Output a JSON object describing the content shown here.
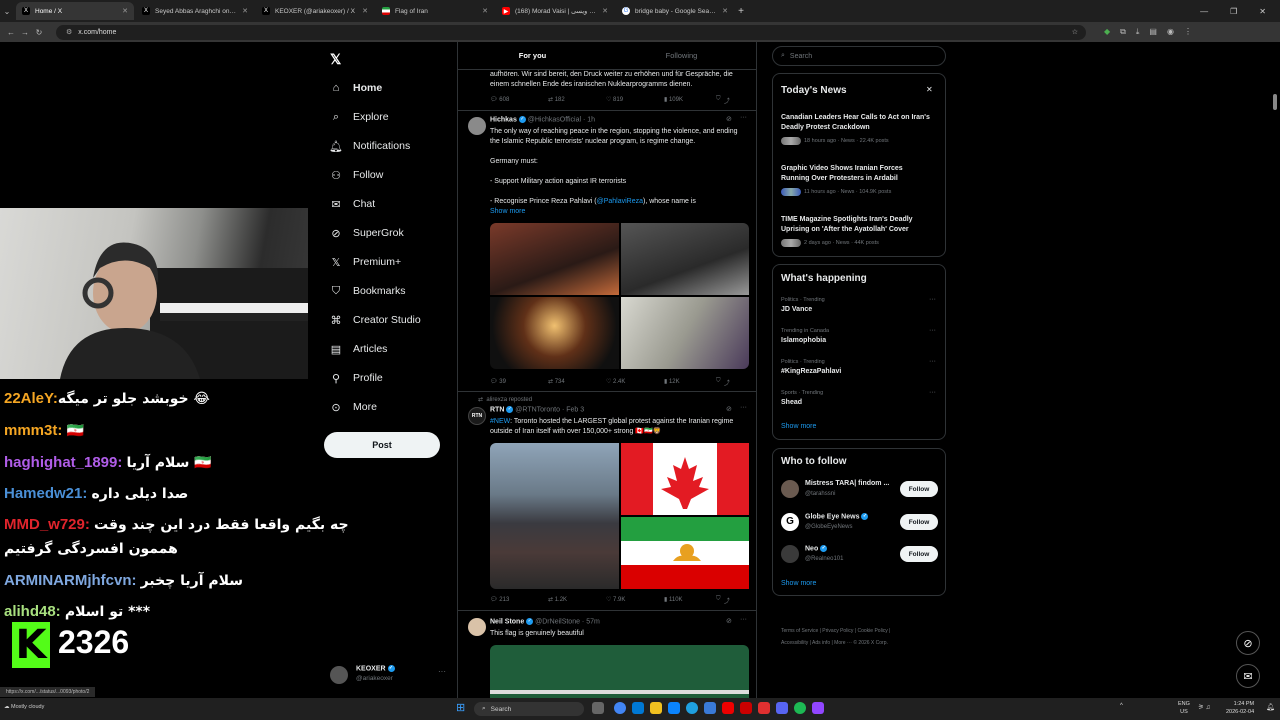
{
  "browser": {
    "tabs": [
      {
        "title": "Home / X",
        "active": true,
        "fav": "X"
      },
      {
        "title": "Seyed Abbas Araghchi on X: \"Ir",
        "active": false,
        "fav": "X"
      },
      {
        "title": "KEOXER (@ariakeoxer) / X",
        "active": false,
        "fav": "X"
      },
      {
        "title": "Flag of Iran",
        "active": false,
        "fav": "flag"
      },
      {
        "title": "(168) Morad Vaisi | مراد ویسی",
        "active": false,
        "fav": "yt"
      },
      {
        "title": "bridge baby - Google Search",
        "active": false,
        "fav": "G"
      }
    ],
    "new_tab": "+",
    "url": "x.com/home",
    "status_url": "https://x.com/.../status/...0093/photo/2"
  },
  "stream": {
    "chat": [
      {
        "user": "22AleY:",
        "msg": "خوبشد جلو تر میگه 😂",
        "color": "#f5a623"
      },
      {
        "user": "mmm3t:",
        "msg": "🇮🇷",
        "color": "#f5a623"
      },
      {
        "user": "haghighat_1899:",
        "msg": "سلام آریا 🇮🇷",
        "color": "#b05de8"
      },
      {
        "user": "Hamedw21:",
        "msg": "صدا دیلی داره",
        "color": "#4a8fd6"
      },
      {
        "user": "MMD_w729:",
        "msg": "چه بگیم واقعا فقط درد این چند وقت",
        "color": "#e0242c"
      },
      {
        "user": "",
        "msg": "هممون افسردگی گرفتیم",
        "color": "#e0242c"
      },
      {
        "user": "ARMINARMjhfcvn:",
        "msg": "سلام آریا چخبر",
        "color": "#7fa8e0"
      },
      {
        "user": "alihd48:",
        "msg": "تو اسلام ***",
        "color": "#a8e07f"
      }
    ],
    "kick_logo": "K",
    "viewer_count": "2326"
  },
  "nav": {
    "items": [
      {
        "label": "Home",
        "icon": "home-icon"
      },
      {
        "label": "Explore",
        "icon": "search-icon"
      },
      {
        "label": "Notifications",
        "icon": "bell-icon"
      },
      {
        "label": "Follow",
        "icon": "follow-icon"
      },
      {
        "label": "Chat",
        "icon": "chat-icon"
      },
      {
        "label": "SuperGrok",
        "icon": "grok-icon"
      },
      {
        "label": "Premium+",
        "icon": "x-icon"
      },
      {
        "label": "Bookmarks",
        "icon": "bookmark-icon"
      },
      {
        "label": "Creator Studio",
        "icon": "studio-icon"
      },
      {
        "label": "Articles",
        "icon": "articles-icon"
      },
      {
        "label": "Profile",
        "icon": "profile-icon"
      },
      {
        "label": "More",
        "icon": "more-icon"
      }
    ],
    "post_label": "Post",
    "account_name": "KEOXER",
    "account_handle": "@ariakeoxer"
  },
  "feed": {
    "tabs": [
      "For you",
      "Following"
    ],
    "tweet0": {
      "text": "aufhören. Wir sind bereit, den Druck weiter zu erhöhen und für Gespräche, die einem schnellen Ende des iranischen Nuklearprogramms dienen.",
      "stats": [
        "608",
        "182",
        "819",
        "109K"
      ]
    },
    "tweet1": {
      "name": "Hichkas",
      "handle": "@HichkasOfficial · 1h",
      "line1": "The only way of reaching peace in the region, stopping the violence, and ending the Islamic Republic terrorists' nuclear program, is regime change.",
      "line2": "Germany must:",
      "line3": "- Support Military action against IR terrorists",
      "line4a": "- Recognise Prince Reza Pahlavi (",
      "line4b": "@PahlaviReza",
      "line4c": "), whose name is",
      "show_more": "Show more",
      "stats": [
        "39",
        "734",
        "2.4K",
        "12K"
      ]
    },
    "tweet2": {
      "repost": "alirexza reposted",
      "name": "RTN",
      "handle": "@RTNToronto · Feb 3",
      "tag": "#NEW",
      "text": ": Toronto hosted the LARGEST global protest against the Iranian regime outside of Iran itself with over 150,000+ strong 🇨🇦🇮🇷🦁",
      "stats": [
        "213",
        "1.2K",
        "7.9K",
        "110K"
      ]
    },
    "tweet3": {
      "name": "Neil Stone",
      "handle": "@DrNeilStone · 57m",
      "text": "This flag is genuinely beautiful"
    }
  },
  "right": {
    "search_placeholder": "Search",
    "news_title": "Today's News",
    "news": [
      {
        "headline": "Canadian Leaders Hear Calls to Act on Iran's Deadly Protest Crackdown",
        "meta": "18 hours ago · News · 22.4K posts"
      },
      {
        "headline": "Graphic Video Shows Iranian Forces Running Over Protesters in Ardabil",
        "meta": "11 hours ago · News · 104.9K posts"
      },
      {
        "headline": "TIME Magazine Spotlights Iran's Deadly Uprising on 'After the Ayatollah' Cover",
        "meta": "2 days ago · News · 44K posts"
      }
    ],
    "happening_title": "What's happening",
    "trends": [
      {
        "cat": "Politics · Trending",
        "name": "JD Vance"
      },
      {
        "cat": "Trending in Canada",
        "name": "Islamophobia"
      },
      {
        "cat": "Politics · Trending",
        "name": "#KingRezaPahlavi"
      },
      {
        "cat": "Sports · Trending",
        "name": "Shead"
      }
    ],
    "show_more": "Show more",
    "wtf_title": "Who to follow",
    "follow": [
      {
        "name": "Mistress TARA| findom ...",
        "handle": "@tarahssni",
        "btn": "Follow"
      },
      {
        "name": "Globe Eye News",
        "handle": "@GlobeEyeNews",
        "btn": "Follow"
      },
      {
        "name": "Neo",
        "handle": "@Realneo101",
        "btn": "Follow"
      }
    ],
    "footer1": "Terms of Service  |  Privacy Policy  |  Cookie Policy  |",
    "footer2": "Accessibility  |  Ads info  |  More ···  © 2026 X Corp."
  },
  "taskbar": {
    "search": "Search",
    "lang1": "ENG",
    "lang2": "US",
    "time": "1:24 PM",
    "date": "2026-02-04",
    "weather": "Mostly cloudy"
  }
}
